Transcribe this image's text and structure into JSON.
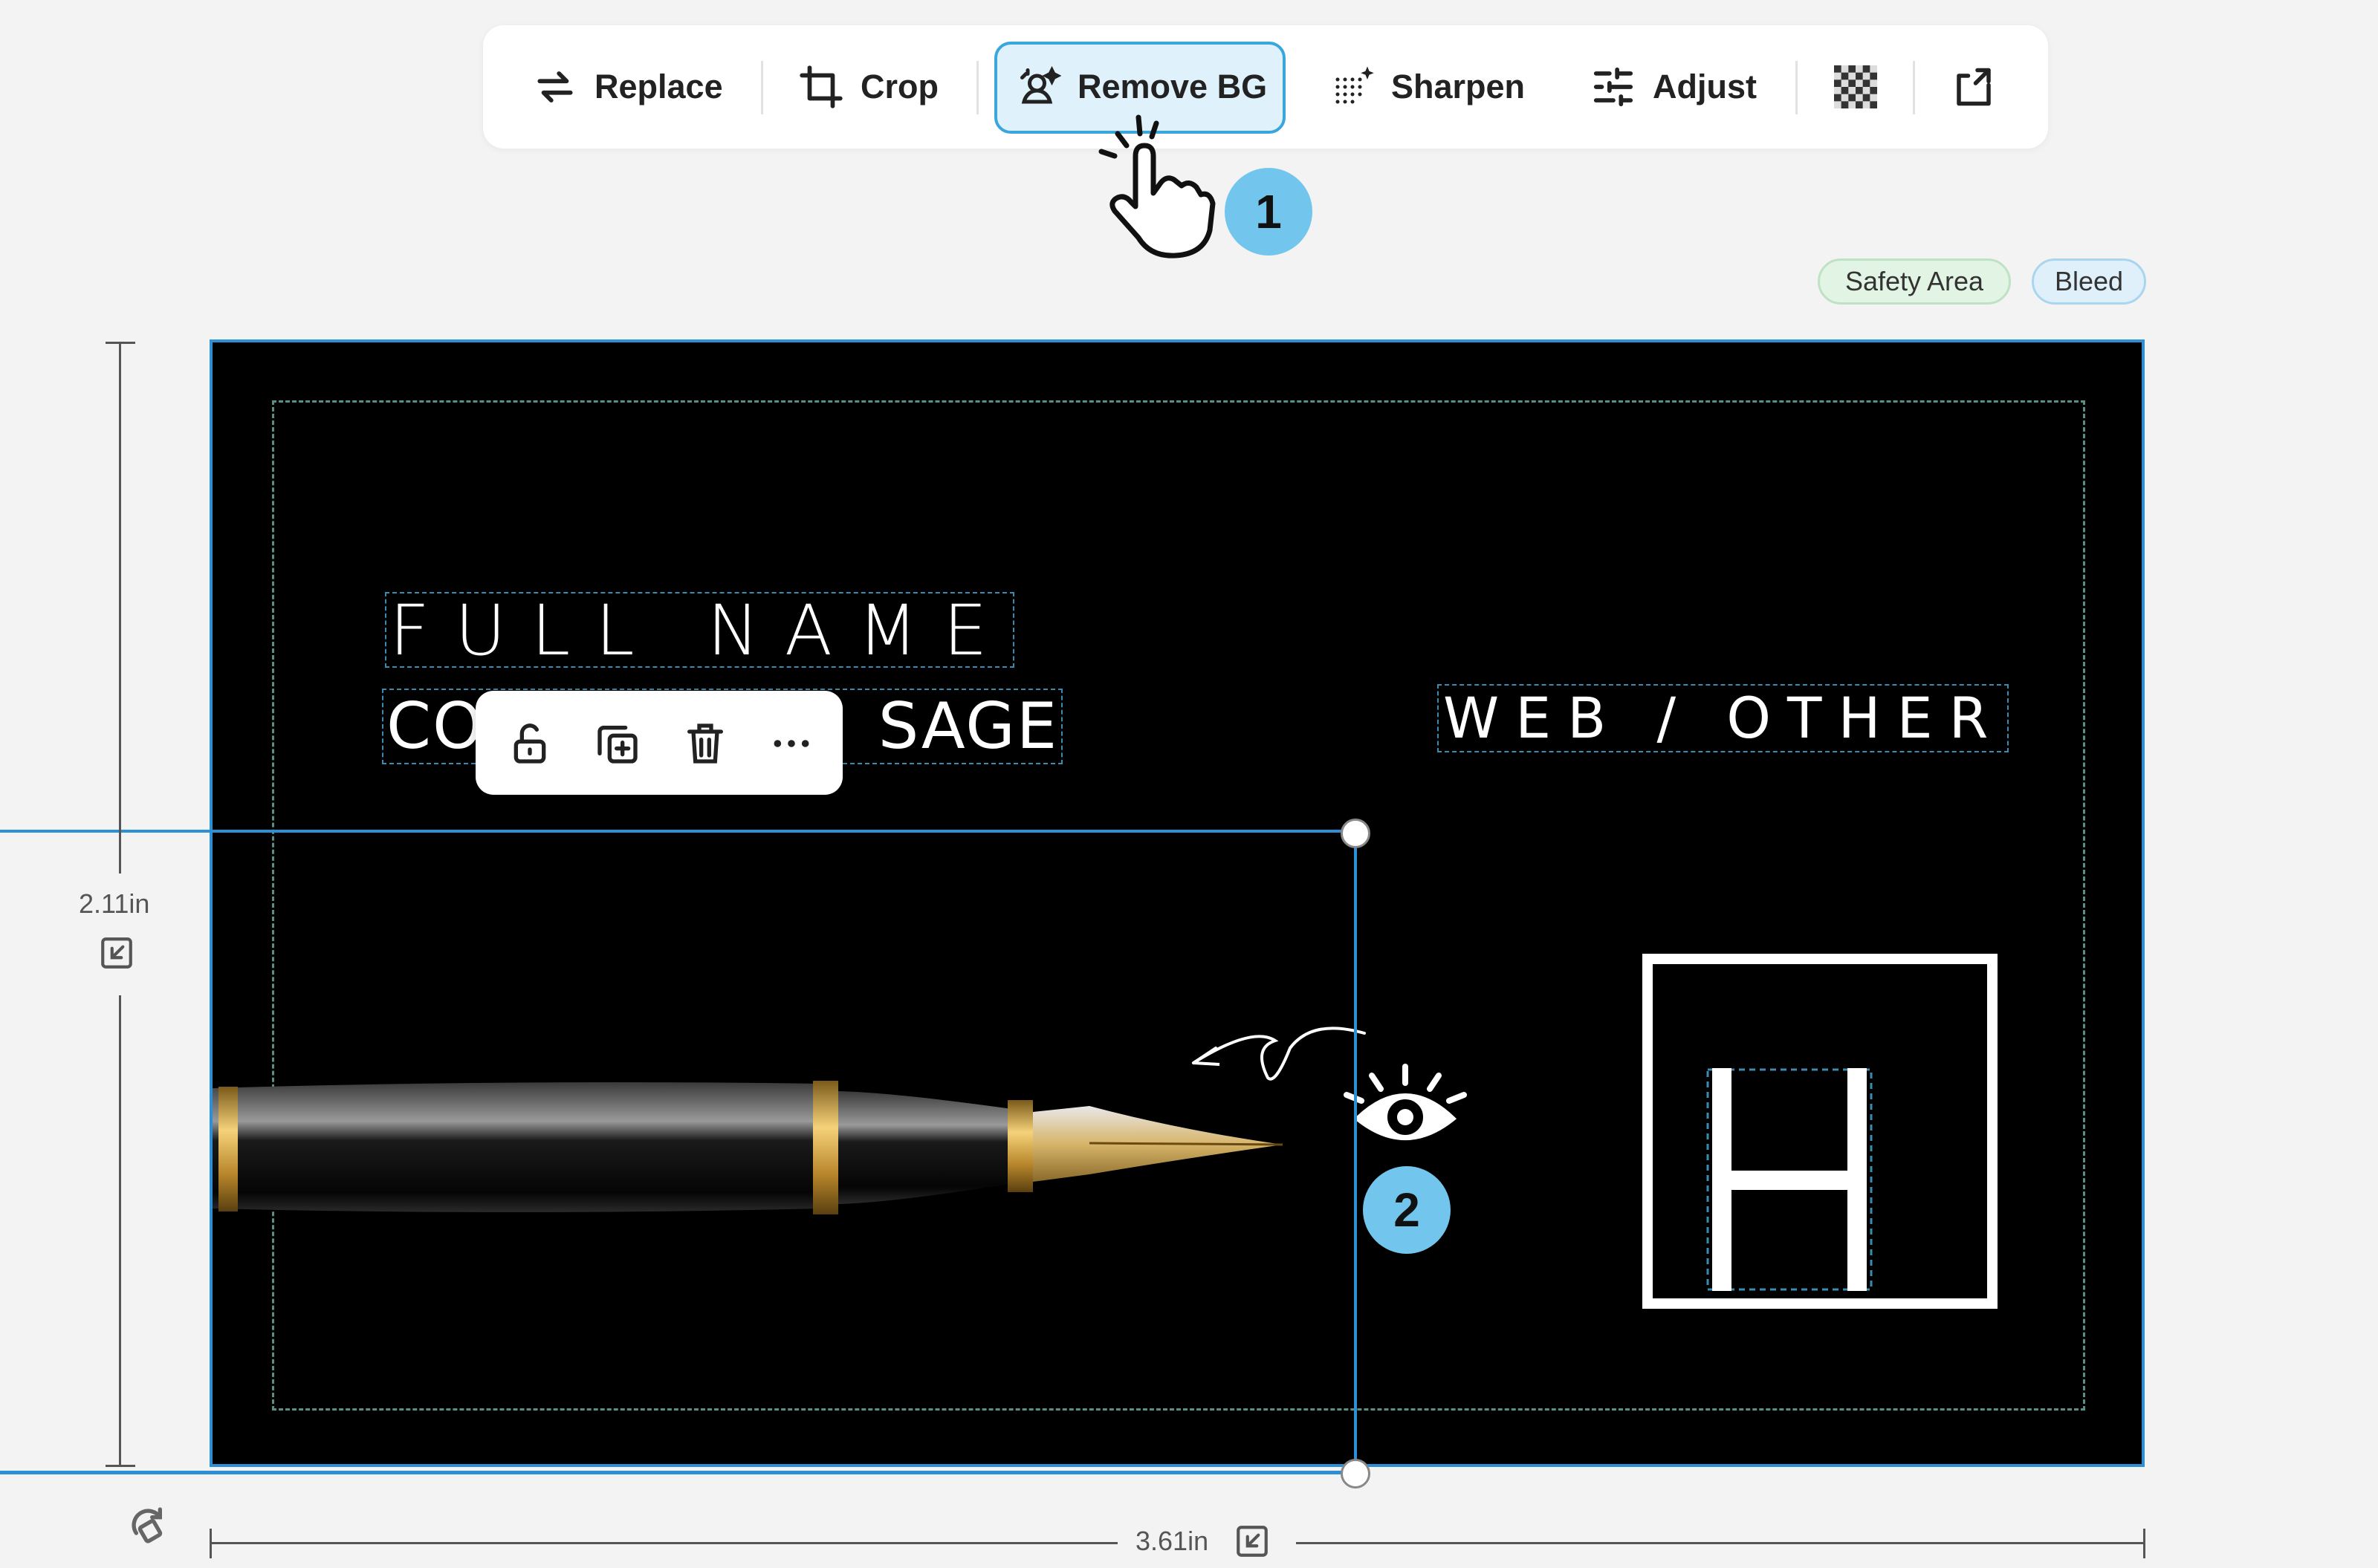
{
  "toolbar": {
    "replace_label": "Replace",
    "crop_label": "Crop",
    "remove_bg_label": "Remove BG",
    "sharpen_label": "Sharpen",
    "adjust_label": "Adjust",
    "icons": [
      "replace-icon",
      "crop-icon",
      "remove-bg-icon",
      "sharpen-icon",
      "adjust-icon",
      "transparency-icon",
      "export-icon"
    ]
  },
  "callouts": {
    "step_1": "1",
    "step_2": "2"
  },
  "tags": {
    "safety_area": "Safety Area",
    "bleed": "Bleed"
  },
  "card": {
    "full_name": "FULL NAME",
    "company_left": "CO",
    "company_right": "SAGE",
    "web": "WEB / OTHER",
    "logo_letter": "H"
  },
  "context_menu": {
    "icons": [
      "unlock-icon",
      "duplicate-icon",
      "trash-icon",
      "more-icon"
    ]
  },
  "dimensions": {
    "height": "2.11in",
    "width": "3.61in"
  },
  "colors": {
    "accent": "#2d8fd6",
    "active_bg": "#dff1fb",
    "callout": "#72c6ee",
    "card_bg": "#000000"
  }
}
